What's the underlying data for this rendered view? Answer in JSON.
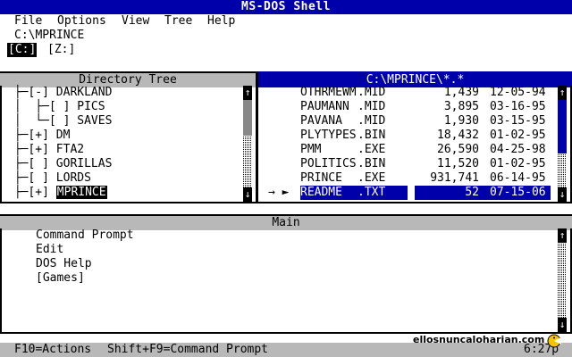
{
  "window": {
    "title": "MS-DOS Shell"
  },
  "menu": {
    "items": [
      "File",
      "Options",
      "View",
      "Tree",
      "Help"
    ]
  },
  "current_path": "C:\\MPRINCE",
  "drives": [
    {
      "label": "[C:]",
      "active": true
    },
    {
      "label": "[Z:]",
      "active": false
    }
  ],
  "directory_tree": {
    "title": "Directory Tree",
    "lines": [
      {
        "prefix": " ├─[-] ",
        "name": "DARKLAND",
        "selected": false
      },
      {
        "prefix": " │  ├─[ ] ",
        "name": "PICS",
        "selected": false
      },
      {
        "prefix": " │  └─[ ] ",
        "name": "SAVES",
        "selected": false
      },
      {
        "prefix": " ├─[+] ",
        "name": "DM",
        "selected": false
      },
      {
        "prefix": " ├─[+] ",
        "name": "FTA2",
        "selected": false
      },
      {
        "prefix": " ├─[ ] ",
        "name": "GORILLAS",
        "selected": false
      },
      {
        "prefix": " ├─[ ] ",
        "name": "LORDS",
        "selected": false
      },
      {
        "prefix": " ├─[+] ",
        "name": "MPRINCE",
        "selected": true
      }
    ]
  },
  "file_list": {
    "title": "C:\\MPRINCE\\*.*",
    "files": [
      {
        "name": "OTHRMEWM",
        "ext": ".MID",
        "size": "1,439",
        "date": "12-05-94"
      },
      {
        "name": "PAUMANN",
        "ext": ".MID",
        "size": "3,895",
        "date": "03-16-95"
      },
      {
        "name": "PAVANA",
        "ext": ".MID",
        "size": "1,930",
        "date": "03-15-95"
      },
      {
        "name": "PLYTYPES",
        "ext": ".BIN",
        "size": "18,432",
        "date": "01-02-95"
      },
      {
        "name": "PMM",
        "ext": ".EXE",
        "size": "26,590",
        "date": "04-25-98"
      },
      {
        "name": "POLITICS",
        "ext": ".BIN",
        "size": "11,520",
        "date": "01-02-95"
      },
      {
        "name": "PRINCE",
        "ext": ".EXE",
        "size": "931,741",
        "date": "06-14-95"
      },
      {
        "name": "README",
        "ext": ".TXT",
        "size": "52",
        "date": "07-15-06"
      }
    ],
    "selected_index": 7,
    "pointer": "→ ►"
  },
  "main_group": {
    "title": "Main",
    "items": [
      "Command Prompt",
      "Edit",
      "DOS Help",
      "[Games]"
    ]
  },
  "status": {
    "actions": "F10=Actions",
    "command_prompt": "Shift+F9=Command Prompt",
    "time": "6:27p"
  },
  "watermark": "ellosnuncaloharian.com",
  "colors": {
    "highlight": "#0000aa",
    "panel_header": "#b8b8b8"
  }
}
